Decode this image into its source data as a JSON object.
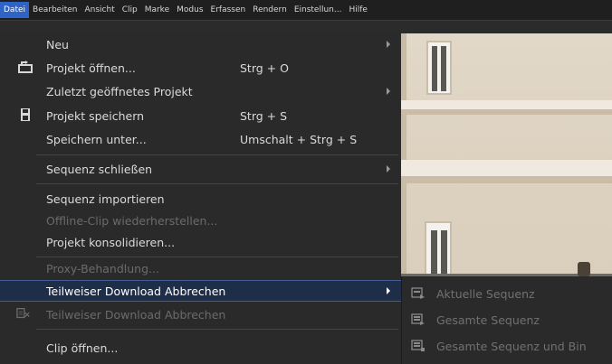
{
  "menubar": {
    "items": [
      {
        "label": "Datei",
        "active": true
      },
      {
        "label": "Bearbeiten"
      },
      {
        "label": "Ansicht"
      },
      {
        "label": "Clip"
      },
      {
        "label": "Marke"
      },
      {
        "label": "Modus"
      },
      {
        "label": "Erfassen"
      },
      {
        "label": "Rendern"
      },
      {
        "label": "Einstellun..."
      },
      {
        "label": "Hilfe"
      }
    ]
  },
  "file_menu": {
    "items": [
      {
        "label": "Neu",
        "has_submenu": true
      },
      {
        "label": "Projekt öffnen...",
        "shortcut": "Strg + O",
        "icon": "open-project-icon"
      },
      {
        "label": "Zuletzt geöffnetes Projekt",
        "has_submenu": true
      },
      {
        "label": "Projekt speichern",
        "shortcut": "Strg + S",
        "icon": "save-icon"
      },
      {
        "label": "Speichern unter...",
        "shortcut": "Umschalt + Strg + S"
      },
      {
        "label": "Sequenz schließen",
        "has_submenu": true
      },
      {
        "label": "Sequenz importieren"
      },
      {
        "label": "Offline-Clip wiederherstellen...",
        "disabled": true
      },
      {
        "label": "Projekt konsolidieren..."
      },
      {
        "label": "Proxy-Behandlung...",
        "disabled": true
      },
      {
        "label": "Teilweiser Download Abbrechen",
        "has_submenu": true,
        "highlighted": true
      },
      {
        "label": "Teilweiser Download Abbrechen",
        "disabled": true,
        "icon": "cancel-download-icon"
      },
      {
        "label": "Clip öffnen..."
      }
    ]
  },
  "submenu": {
    "items": [
      {
        "label": "Aktuelle Sequenz",
        "icon": "current-sequence-icon",
        "disabled": true
      },
      {
        "label": "Gesamte Sequenz",
        "icon": "whole-sequence-icon",
        "disabled": true
      },
      {
        "label": "Gesamte Sequenz und Bin",
        "icon": "sequence-and-bin-icon",
        "disabled": true
      }
    ]
  },
  "colors": {
    "menubar_bg": "#1f1f1f",
    "menu_bg": "#2a2a2a",
    "active_menu": "#2f63c6",
    "highlight_border": "#3f5f92",
    "text": "#dadada",
    "disabled_text": "#6b6b6b"
  }
}
